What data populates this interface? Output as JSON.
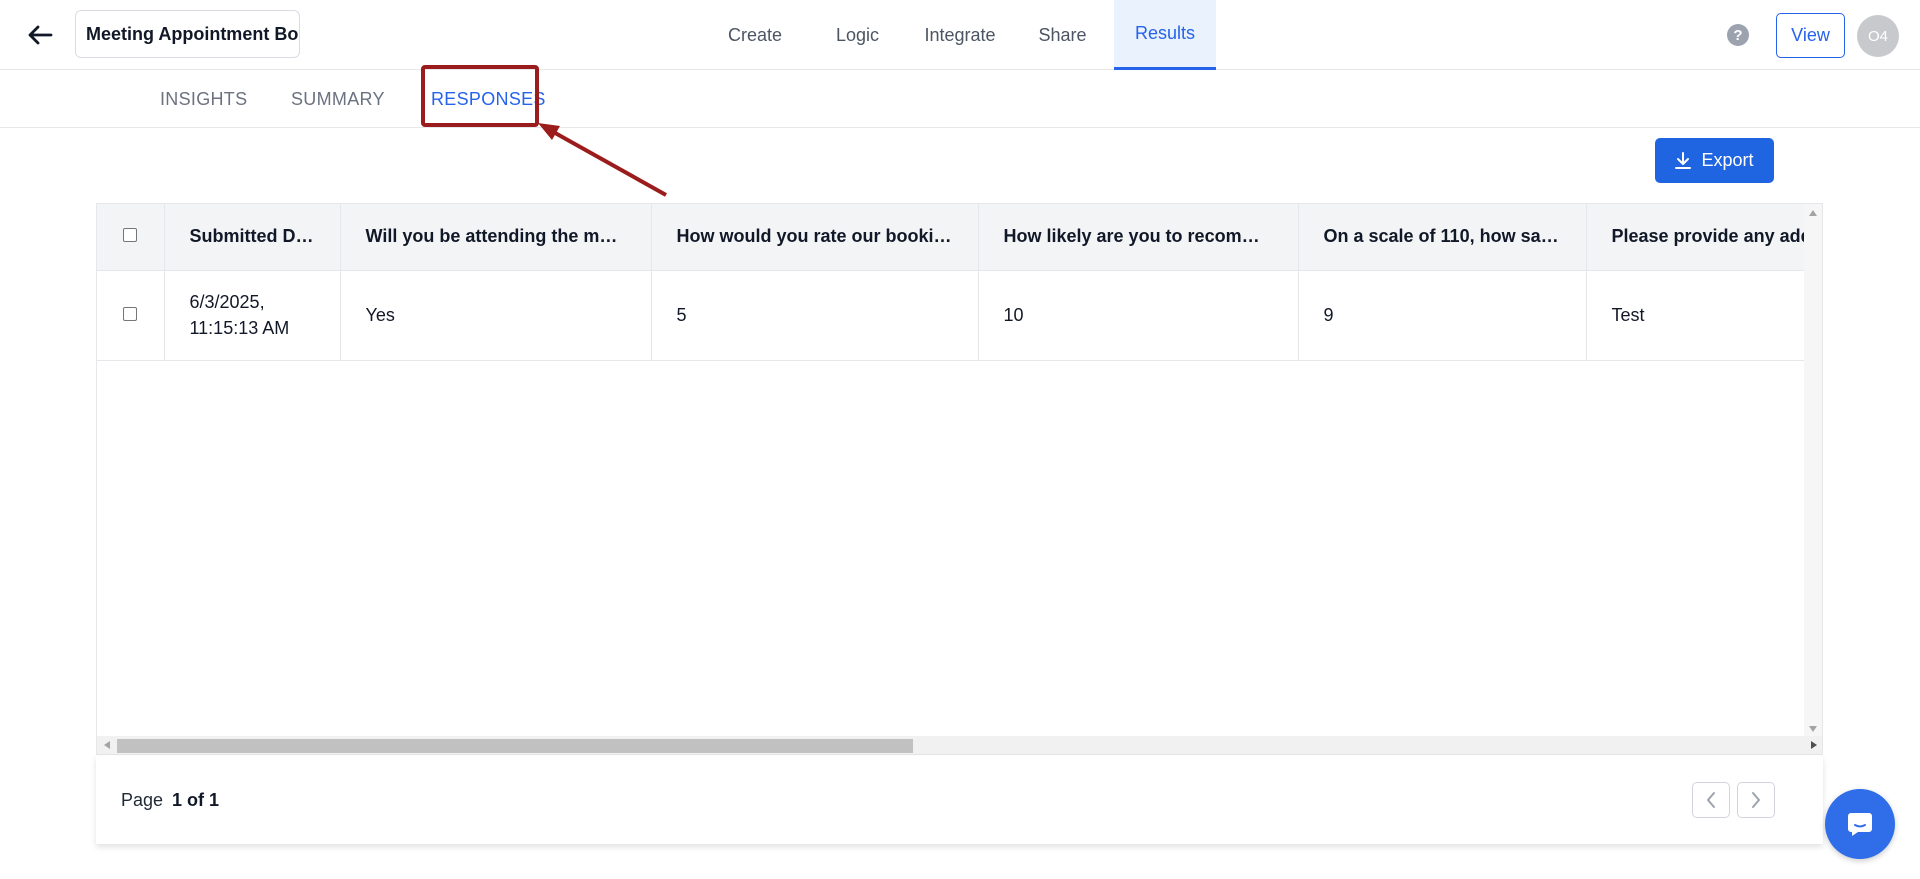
{
  "header": {
    "form_title": "Meeting Appointment Bo",
    "nav": [
      {
        "label": "Create"
      },
      {
        "label": "Logic"
      },
      {
        "label": "Integrate"
      },
      {
        "label": "Share"
      },
      {
        "label": "Results",
        "active": true
      }
    ],
    "help_icon": "?",
    "view_label": "View",
    "avatar_initials": "O4"
  },
  "subtabs": [
    {
      "label": "INSIGHTS"
    },
    {
      "label": "SUMMARY"
    },
    {
      "label": "RESPONSES",
      "active": true
    }
  ],
  "toolbar": {
    "export_label": "Export"
  },
  "table": {
    "headers": [
      "Submitted Date",
      "Will you be attending the meet...",
      "How would you rate our booking...",
      "How likely are you to recommen...",
      "On a scale of 110, how satisfi...",
      "Please provide any additional"
    ],
    "rows": [
      {
        "submitted_date": "6/3/2025, 11:15:13 AM",
        "cells": [
          "Yes",
          "5",
          "10",
          "9",
          "Test"
        ]
      }
    ]
  },
  "pagination": {
    "page_label": "Page",
    "page_value": "1 of 1"
  },
  "colors": {
    "accent": "#2563eb",
    "annotation": "#9b1c1c",
    "chat": "#2f6ee8"
  },
  "icons": {
    "back": "arrow-left-icon",
    "help": "question-circle-icon",
    "export": "download-icon",
    "prev": "chevron-left-icon",
    "next": "chevron-right-icon",
    "chat": "chat-icon"
  }
}
